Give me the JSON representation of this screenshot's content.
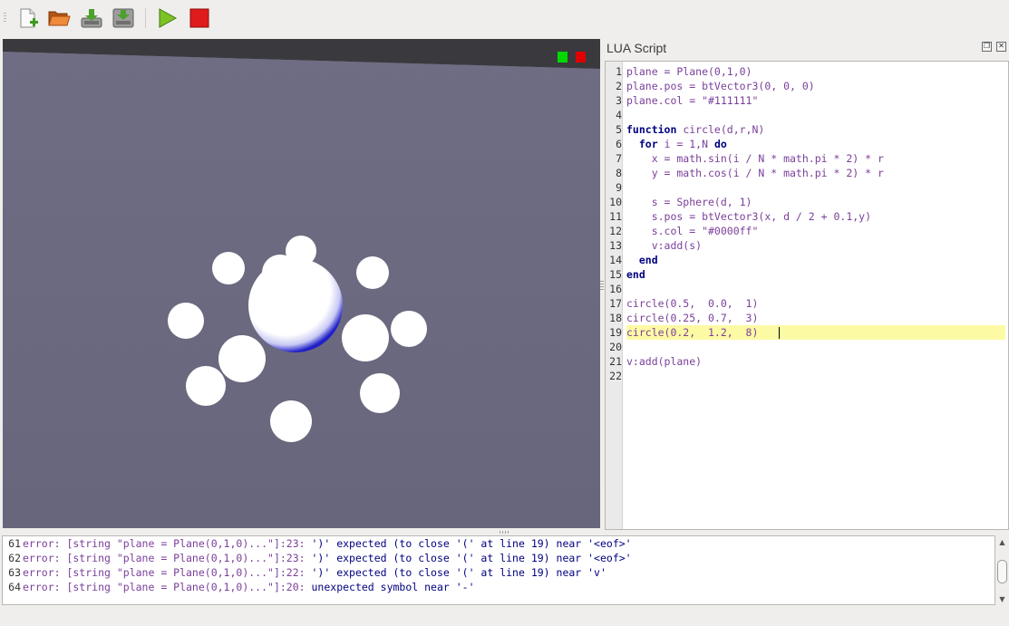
{
  "toolbar": {
    "buttons": [
      {
        "name": "new-file",
        "icon": "new-file-icon"
      },
      {
        "name": "open-file",
        "icon": "folder-open-icon"
      },
      {
        "name": "save",
        "icon": "save-icon"
      },
      {
        "name": "save-as",
        "icon": "save-as-icon"
      },
      {
        "name": "run",
        "icon": "play-icon"
      },
      {
        "name": "stop",
        "icon": "stop-icon"
      }
    ]
  },
  "viewport": {
    "background_color": "#6d6b81",
    "indicator_colors": [
      "#00d800",
      "#e00000"
    ]
  },
  "dock": {
    "title": "LUA Script",
    "float_icon": "float-window-icon",
    "close_icon": "close-icon"
  },
  "editor": {
    "highlight_color": "#fdfaa4",
    "current_line": 19,
    "lines": [
      {
        "n": "1",
        "text": "plane = Plane(0,1,0)"
      },
      {
        "n": "2",
        "text": "plane.pos = btVector3(0, 0, 0)"
      },
      {
        "n": "3",
        "text": "plane.col = \"#111111\""
      },
      {
        "n": "4",
        "text": ""
      },
      {
        "n": "5",
        "text": "function circle(d,r,N)"
      },
      {
        "n": "6",
        "text": "  for i = 1,N do"
      },
      {
        "n": "7",
        "text": "    x = math.sin(i / N * math.pi * 2) * r"
      },
      {
        "n": "8",
        "text": "    y = math.cos(i / N * math.pi * 2) * r"
      },
      {
        "n": "9",
        "text": ""
      },
      {
        "n": "10",
        "text": "    s = Sphere(d, 1)"
      },
      {
        "n": "11",
        "text": "    s.pos = btVector3(x, d / 2 + 0.1,y)"
      },
      {
        "n": "12",
        "text": "    s.col = \"#0000ff\""
      },
      {
        "n": "13",
        "text": "    v:add(s)"
      },
      {
        "n": "14",
        "text": "  end"
      },
      {
        "n": "15",
        "text": "end"
      },
      {
        "n": "16",
        "text": ""
      },
      {
        "n": "17",
        "text": "circle(0.5,  0.0,  1)"
      },
      {
        "n": "18",
        "text": "circle(0.25, 0.7,  3)"
      },
      {
        "n": "19",
        "text": "circle(0.2,  1.2,  8)"
      },
      {
        "n": "20",
        "text": ""
      },
      {
        "n": "21",
        "text": "v:add(plane)"
      },
      {
        "n": "22",
        "text": ""
      }
    ]
  },
  "console": {
    "lines": [
      {
        "n": "61",
        "prefix": "error: [string \"plane = Plane(0,1,0)...\"]:23: ",
        "message": "')' expected (to close '(' at line 19) near '<eof>'"
      },
      {
        "n": "62",
        "prefix": "error: [string \"plane = Plane(0,1,0)...\"]:23: ",
        "message": "')' expected (to close '(' at line 19) near '<eof>'"
      },
      {
        "n": "63",
        "prefix": "error: [string \"plane = Plane(0,1,0)...\"]:22: ",
        "message": "')' expected (to close '(' at line 19) near 'v'"
      },
      {
        "n": "64",
        "prefix": "error: [string \"plane = Plane(0,1,0)...\"]:20: ",
        "message": "unexpected symbol near '-'"
      }
    ]
  }
}
